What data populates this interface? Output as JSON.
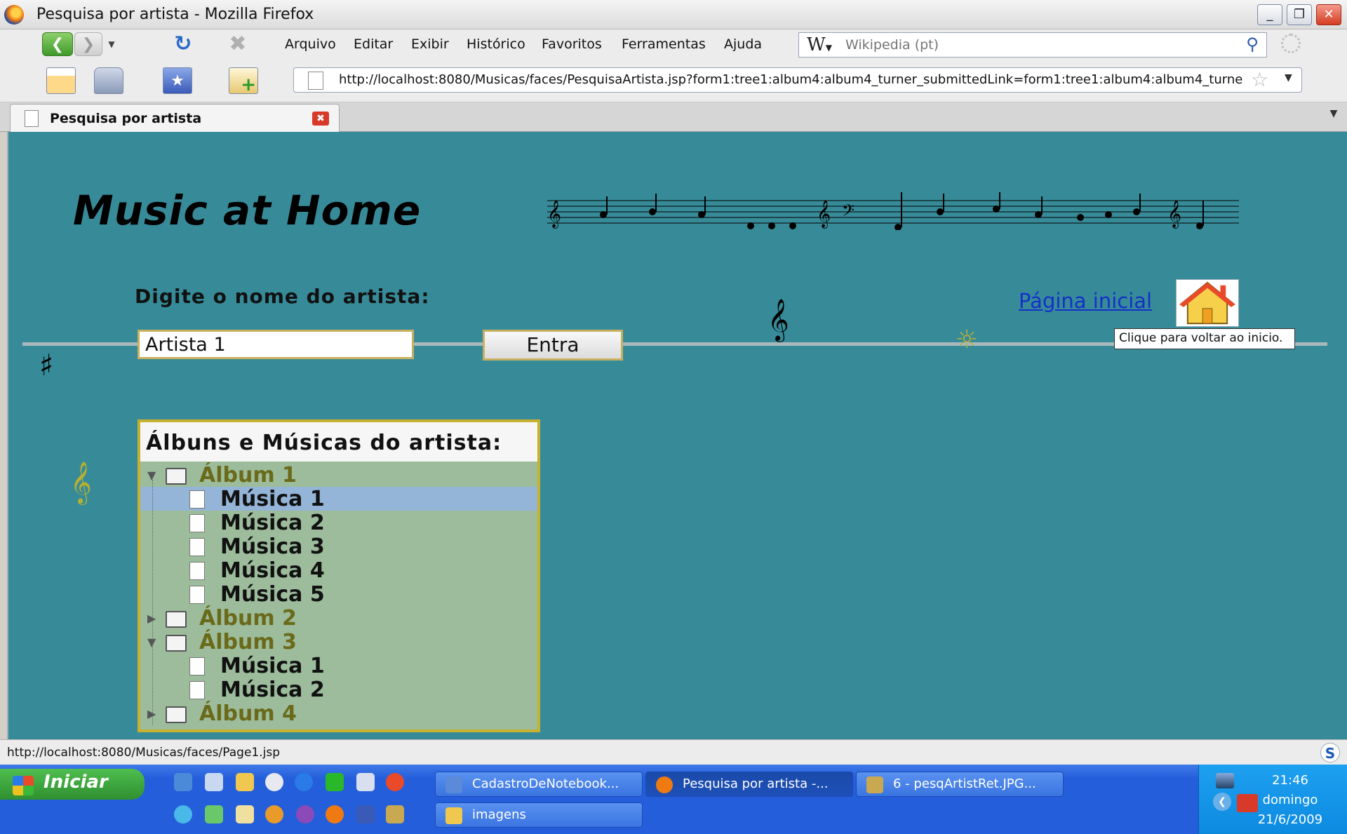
{
  "window": {
    "title": "Pesquisa por artista - Mozilla Firefox",
    "minimize": "_",
    "maximize": "❐",
    "close": "✕"
  },
  "menu": [
    "Arquivo",
    "Editar",
    "Exibir",
    "Histórico",
    "Favoritos",
    "Ferramentas",
    "Ajuda"
  ],
  "search": {
    "engine": "W",
    "placeholder": "Wikipedia (pt)"
  },
  "url": "http://localhost:8080/Musicas/faces/PesquisaArtista.jsp?form1:tree1:album4:album4_turner_submittedLink=form1:tree1:album4:album4_turne",
  "tab": {
    "label": "Pesquisa por artista"
  },
  "page": {
    "logo_title": "Music at Home",
    "prompt": "Digite o nome do artista:",
    "artist_value": "Artista 1",
    "submit_label": "Entra",
    "home_link": "Página inicial",
    "home_tooltip": "Clique para voltar ao inicio.",
    "tree_header": "Álbuns e Músicas do artista:",
    "tree": [
      {
        "type": "album",
        "label": "Álbum 1",
        "expanded": true
      },
      {
        "type": "song",
        "label": "Música 1",
        "selected": true
      },
      {
        "type": "song",
        "label": "Música 2"
      },
      {
        "type": "song",
        "label": "Música 3"
      },
      {
        "type": "song",
        "label": "Música 4"
      },
      {
        "type": "song",
        "label": "Música 5"
      },
      {
        "type": "album",
        "label": "Álbum 2",
        "expanded": false
      },
      {
        "type": "album",
        "label": "Álbum 3",
        "expanded": true
      },
      {
        "type": "song",
        "label": "Música 1"
      },
      {
        "type": "song",
        "label": "Música 2"
      },
      {
        "type": "album",
        "label": "Álbum 4",
        "expanded": false
      }
    ]
  },
  "status": {
    "text": "http://localhost:8080/Musicas/faces/Page1.jsp"
  },
  "taskbar": {
    "start_label": "Iniciar",
    "tasks": [
      {
        "label": "CadastroDeNotebook...",
        "active": false
      },
      {
        "label": "Pesquisa por artista -...",
        "active": true
      },
      {
        "label": "6 - pesqArtistRet.JPG...",
        "active": false
      },
      {
        "label": "imagens",
        "active": false
      }
    ],
    "clock": {
      "time": "21:46",
      "day": "domingo",
      "date": "21/6/2009"
    }
  },
  "colors": {
    "page_background": "#378b99",
    "tree_background": "#9cbc9c",
    "tree_border": "#c8b030",
    "selected_row": "#94b4d8",
    "link": "#1530c8"
  },
  "icons": [
    "firefox-icon",
    "back-icon",
    "forward-icon",
    "reload-icon",
    "stop-icon",
    "search-icon",
    "page-icon",
    "star-icon",
    "home-icon",
    "treble-clef-icon",
    "folder-icon",
    "file-icon"
  ]
}
